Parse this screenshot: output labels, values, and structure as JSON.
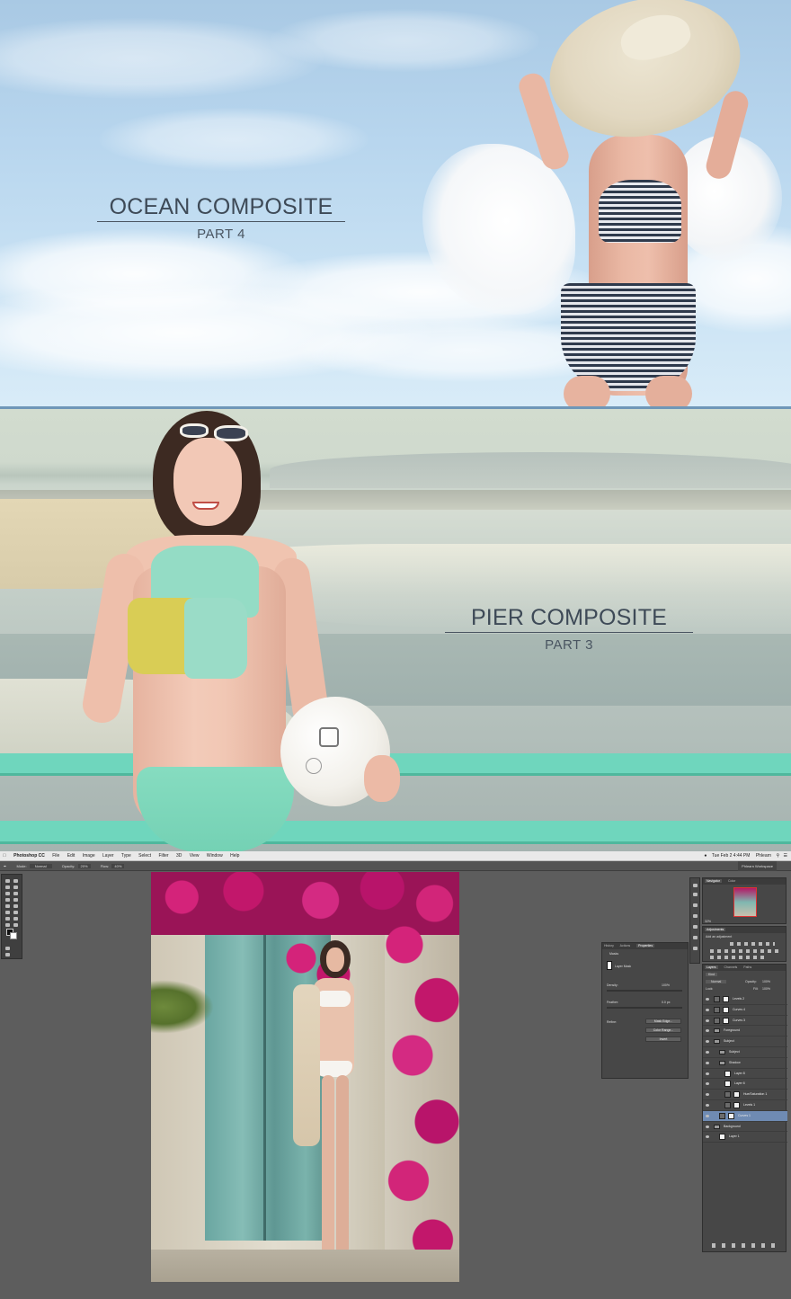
{
  "ocean": {
    "title": "OCEAN COMPOSITE",
    "subtitle": "PART 4"
  },
  "pier": {
    "title": "PIER COMPOSITE",
    "subtitle": "PART 3"
  },
  "photoshop": {
    "menubar": {
      "app": "Photoshop CC",
      "items": [
        "File",
        "Edit",
        "Image",
        "Layer",
        "Type",
        "Select",
        "Filter",
        "3D",
        "View",
        "Window",
        "Help"
      ],
      "clock": "Tue Feb 2  4:44 PM",
      "user": "Phlearn"
    },
    "options": {
      "mode_label": "Mode:",
      "mode_value": "Normal",
      "opacity_label": "Opacity:",
      "opacity_value": "20%",
      "flow_label": "Flow:",
      "flow_value": "40%",
      "workspace": "Phlearn Workspace"
    },
    "properties": {
      "tabs": [
        "History",
        "Actions",
        "Properties"
      ],
      "section": "Masks",
      "layer_mask_label": "Layer Mask",
      "density_label": "Density:",
      "density_value": "100%",
      "feather_label": "Feather:",
      "feather_value": "0.0 px",
      "refine_label": "Refine:",
      "buttons": [
        "Mask Edge...",
        "Color Range...",
        "Invert"
      ]
    },
    "navigator": {
      "tabs": [
        "Navigator",
        "Color"
      ],
      "zoom": "32%"
    },
    "adjustments": {
      "tabs": [
        "Adjustments"
      ],
      "hint": "Add an adjustment"
    },
    "layers": {
      "tabs": [
        "Layers",
        "Channels",
        "Paths"
      ],
      "kind_label": "Kind",
      "blend_mode": "Normal",
      "opacity_label": "Opacity:",
      "opacity_value": "100%",
      "lock_label": "Lock:",
      "fill_label": "Fill:",
      "fill_value": "100%",
      "rows": [
        {
          "name": "Levels 2",
          "indent": 0,
          "type": "adjust"
        },
        {
          "name": "Curves 4",
          "indent": 0,
          "type": "adjust"
        },
        {
          "name": "Curves 3",
          "indent": 0,
          "type": "adjust"
        },
        {
          "name": "Foreground",
          "indent": 0,
          "type": "group"
        },
        {
          "name": "Subject",
          "indent": 0,
          "type": "group"
        },
        {
          "name": "Subject",
          "indent": 1,
          "type": "group"
        },
        {
          "name": "Shadow",
          "indent": 1,
          "type": "group"
        },
        {
          "name": "Layer 8",
          "indent": 2,
          "type": "pixel"
        },
        {
          "name": "Layer 6",
          "indent": 2,
          "type": "pixel"
        },
        {
          "name": "Hue/Saturation 1",
          "indent": 2,
          "type": "adjust"
        },
        {
          "name": "Levels 1",
          "indent": 2,
          "type": "adjust"
        },
        {
          "name": "Curves 1",
          "indent": 1,
          "type": "adjust",
          "selected": true
        },
        {
          "name": "Background",
          "indent": 0,
          "type": "group"
        },
        {
          "name": "Layer 1",
          "indent": 1,
          "type": "pixel"
        }
      ]
    },
    "colors": {
      "bougainvillea": "#c2176b",
      "door": "#7fb7b0",
      "wall": "#d8d3c6"
    }
  }
}
